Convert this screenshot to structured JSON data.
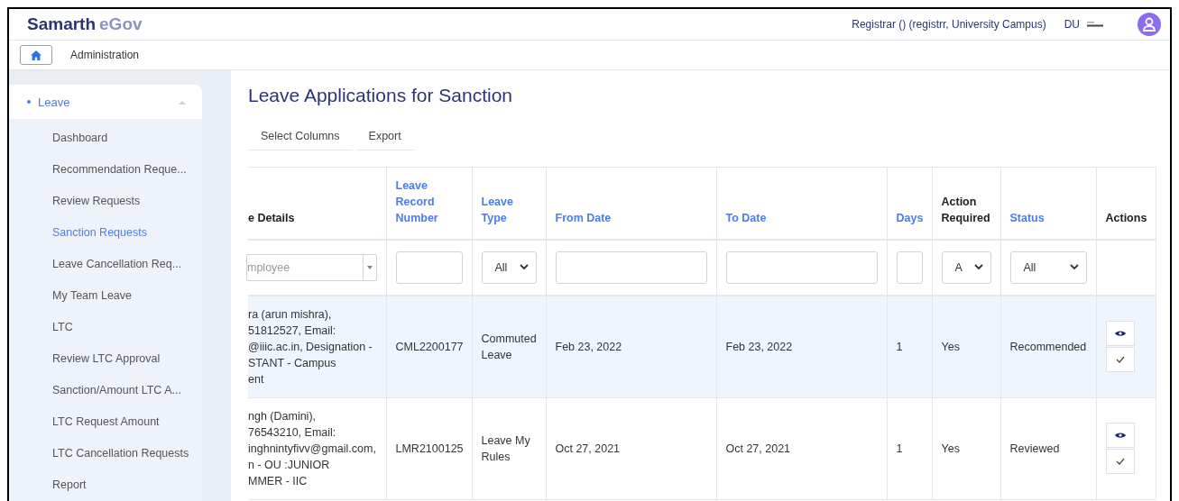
{
  "header": {
    "brand_primary": "Samarth",
    "brand_secondary": "eGov",
    "user": "Registrar () (registrr, University Campus)",
    "org": "DU"
  },
  "breadcrumb": {
    "label": "Administration"
  },
  "sidebar": {
    "group": {
      "label": "Leave",
      "expanded": true
    },
    "items": [
      {
        "label": "Dashboard",
        "selected": false
      },
      {
        "label": "Recommendation Reque...",
        "selected": false
      },
      {
        "label": "Review Requests",
        "selected": false
      },
      {
        "label": "Sanction Requests",
        "selected": true
      },
      {
        "label": "Leave Cancellation Req...",
        "selected": false
      },
      {
        "label": "My Team Leave",
        "selected": false
      },
      {
        "label": "LTC",
        "selected": false
      },
      {
        "label": "Review LTC Approval",
        "selected": false
      },
      {
        "label": "Sanction/Amount LTC A...",
        "selected": false
      },
      {
        "label": "LTC Request Amount",
        "selected": false
      },
      {
        "label": "LTC Cancellation Requests",
        "selected": false
      },
      {
        "label": "Report",
        "selected": false
      }
    ]
  },
  "page": {
    "title": "Leave Applications for Sanction",
    "toolbar": [
      "Select Columns",
      "Export"
    ]
  },
  "table": {
    "columns": [
      {
        "label": "e Details",
        "sortable": false,
        "filter": {
          "kind": "combo",
          "placeholder": "mployee"
        }
      },
      {
        "label": "Leave Record Number",
        "sortable": true,
        "filter": {
          "kind": "text"
        }
      },
      {
        "label": "Leave Type",
        "sortable": true,
        "filter": {
          "kind": "select",
          "value": "All"
        }
      },
      {
        "label": "From Date",
        "sortable": true,
        "filter": {
          "kind": "text"
        }
      },
      {
        "label": "To Date",
        "sortable": true,
        "filter": {
          "kind": "text"
        }
      },
      {
        "label": "Days",
        "sortable": true,
        "filter": {
          "kind": "text"
        }
      },
      {
        "label": "Action Required",
        "sortable": false,
        "filter": {
          "kind": "select",
          "value": "A"
        }
      },
      {
        "label": "Status",
        "sortable": true,
        "filter": {
          "kind": "select",
          "value": "All"
        }
      },
      {
        "label": "Actions",
        "sortable": false,
        "filter": {
          "kind": "none"
        }
      }
    ],
    "rows": [
      {
        "selected": true,
        "cells": [
          "ra (arun mishra),\n51812527, Email:\n@iiic.ac.in, Designation -\nSTANT - Campus\nent",
          "CML2200177",
          "Commuted Leave",
          "Feb 23, 2022",
          "Feb 23, 2022",
          "1",
          "Yes",
          "Recommended"
        ]
      },
      {
        "selected": false,
        "cells": [
          "ngh (Damini),\n76543210, Email:\ninghnintyfivv@gmail.com,\nn - OU :JUNIOR\nMMER - IIC",
          "LMR2100125",
          "Leave My Rules",
          "Oct 27, 2021",
          "Oct 27, 2021",
          "1",
          "Yes",
          "Reviewed"
        ]
      }
    ]
  }
}
